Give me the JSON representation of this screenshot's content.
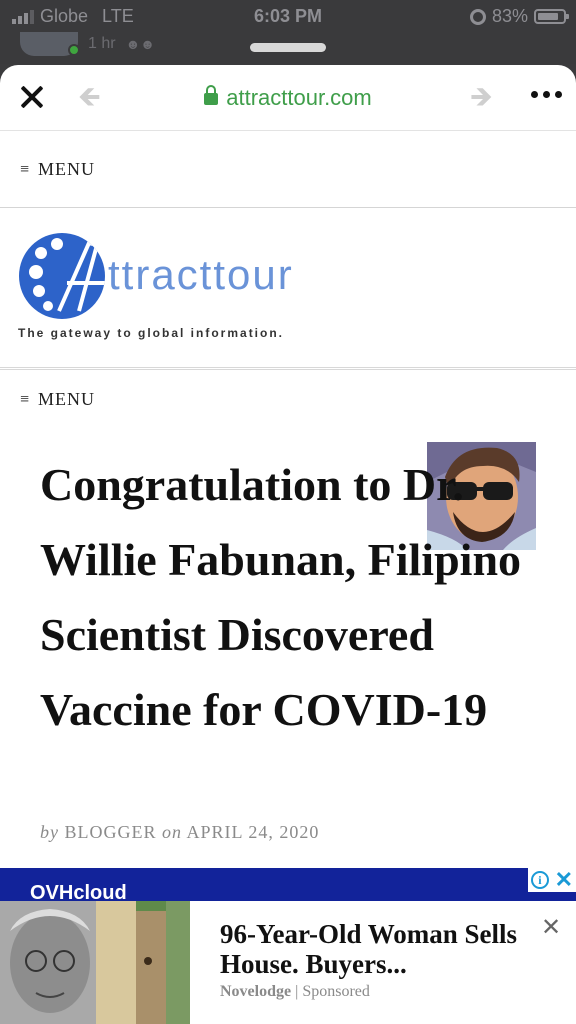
{
  "status_bar": {
    "carrier": "Globe",
    "network": "LTE",
    "time": "6:03 PM",
    "battery": "83%",
    "battery_level": 0.83
  },
  "facebook_post": {
    "time_ago": "1 hr"
  },
  "browser": {
    "url": "attracttour.com",
    "lock_icon": "lock-icon",
    "accent_color": "#3f9e4a"
  },
  "site": {
    "menu_label": "MENU",
    "logo_text": "ttracttour",
    "tagline": "The gateway to global information."
  },
  "article": {
    "title": "Congratulation to Dr. Willie Fabunan, Filipino Scientist Discovered Vaccine for COVID-19",
    "by_prefix": "by",
    "author": "BLOGGER",
    "on_prefix": "on",
    "date": "APRIL 24, 2020"
  },
  "ad": {
    "banner_brand": "OVHcloud",
    "headline": "96-Year-Old Woman Sells House. Buyers...",
    "source": "Novelodge",
    "sponsored": "Sponsored",
    "banner_color": "#12239a"
  }
}
